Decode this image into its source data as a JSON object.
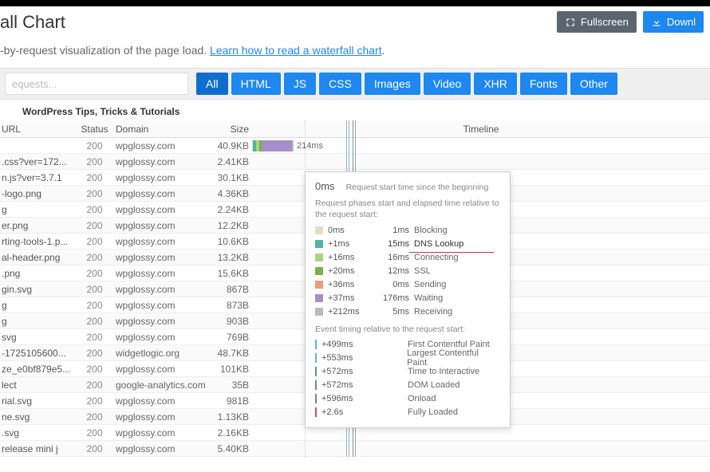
{
  "header": {
    "title_partial": "all Chart",
    "fullscreen": "Fullscreen",
    "download": "Downl"
  },
  "subtitle": {
    "lead": "-by-request visualization of the page load. ",
    "link": "Learn how to read a waterfall chart",
    "tail": "."
  },
  "filter": {
    "placeholder": "equests...",
    "tabs": [
      "All",
      "HTML",
      "JS",
      "CSS",
      "Images",
      "Video",
      "XHR",
      "Fonts",
      "Other"
    ],
    "active": 0
  },
  "page_label": "WordPress Tips, Tricks & Tutorials",
  "columns": {
    "url": "URL",
    "status": "Status",
    "domain": "Domain",
    "size": "Size",
    "timeline": "Timeline"
  },
  "rows": [
    {
      "url": "",
      "status": "200",
      "domain": "wpglossy.com",
      "size": "40.9KB",
      "label": "214ms"
    },
    {
      "url": ".css?ver=172...",
      "status": "200",
      "domain": "wpglossy.com",
      "size": "2.41KB"
    },
    {
      "url": "n.js?ver=3.7.1",
      "status": "200",
      "domain": "wpglossy.com",
      "size": "30.1KB"
    },
    {
      "url": "-logo.png",
      "status": "200",
      "domain": "wpglossy.com",
      "size": "4.36KB"
    },
    {
      "url": "g",
      "status": "200",
      "domain": "wpglossy.com",
      "size": "2.24KB"
    },
    {
      "url": "er.png",
      "status": "200",
      "domain": "wpglossy.com",
      "size": "12.2KB"
    },
    {
      "url": "rting-tools-1.p...",
      "status": "200",
      "domain": "wpglossy.com",
      "size": "10.6KB"
    },
    {
      "url": "al-header.png",
      "status": "200",
      "domain": "wpglossy.com",
      "size": "13.2KB"
    },
    {
      "url": ".png",
      "status": "200",
      "domain": "wpglossy.com",
      "size": "15.6KB"
    },
    {
      "url": "gin.svg",
      "status": "200",
      "domain": "wpglossy.com",
      "size": "867B"
    },
    {
      "url": "g",
      "status": "200",
      "domain": "wpglossy.com",
      "size": "873B"
    },
    {
      "url": "g",
      "status": "200",
      "domain": "wpglossy.com",
      "size": "903B"
    },
    {
      "url": "svg",
      "status": "200",
      "domain": "wpglossy.com",
      "size": "769B"
    },
    {
      "url": "-1725105600...",
      "status": "200",
      "domain": "widgetlogic.org",
      "size": "48.7KB"
    },
    {
      "url": "ze_e0bf879e5...",
      "status": "200",
      "domain": "wpglossy.com",
      "size": "101KB"
    },
    {
      "url": "lect",
      "status": "200",
      "domain": "google-analytics.com",
      "size": "35B"
    },
    {
      "url": "rial.svg",
      "status": "200",
      "domain": "wpglossy.com",
      "size": "981B"
    },
    {
      "url": "ne.svg",
      "status": "200",
      "domain": "wpglossy.com",
      "size": "1.13KB"
    },
    {
      "url": ".svg",
      "status": "200",
      "domain": "wpglossy.com",
      "size": "2.16KB"
    },
    {
      "url": "release mini j",
      "status": "200",
      "domain": "wpglossy.com",
      "size": "5.40KB"
    }
  ],
  "tooltip": {
    "head_time": "0ms",
    "head_label": "Request start time since the beginning",
    "sub1": "Request phases start and elapsed time relative to the request start:",
    "phases": [
      {
        "color": "#e6dcc6",
        "offset": "0ms",
        "dur": "1ms",
        "name": "Blocking"
      },
      {
        "color": "#4fb5a5",
        "offset": "+1ms",
        "dur": "15ms",
        "name": "DNS Lookup",
        "hl": true
      },
      {
        "color": "#a8d582",
        "offset": "+16ms",
        "dur": "16ms",
        "name": "Connecting"
      },
      {
        "color": "#7fb043",
        "offset": "+20ms",
        "dur": "12ms",
        "name": "SSL"
      },
      {
        "color": "#f09a7c",
        "offset": "+36ms",
        "dur": "0ms",
        "name": "Sending"
      },
      {
        "color": "#a58fc9",
        "offset": "+37ms",
        "dur": "176ms",
        "name": "Waiting"
      },
      {
        "color": "#bbb",
        "offset": "+212ms",
        "dur": "5ms",
        "name": "Receiving"
      }
    ],
    "sub2": "Event timing relative to the request start:",
    "events": [
      {
        "color": "#5bb5d6",
        "offset": "+499ms",
        "name": "First Contentful Paint"
      },
      {
        "color": "#5bb5d6",
        "offset": "+553ms",
        "name": "Largest Contentful Paint"
      },
      {
        "color": "#5b9676",
        "offset": "+572ms",
        "name": "Time to Interactive"
      },
      {
        "color": "#5b9676",
        "offset": "+572ms",
        "name": "DOM Loaded"
      },
      {
        "color": "#8b6fb5",
        "offset": "+596ms",
        "name": "Onload"
      },
      {
        "color": "#d44b6e",
        "offset": "+2.6s",
        "name": "Fully Loaded"
      }
    ]
  },
  "chart_data": {
    "type": "table",
    "title": "Waterfall request timing (first request)",
    "series": [
      {
        "name": "Blocking",
        "values": [
          1
        ]
      },
      {
        "name": "DNS Lookup",
        "values": [
          15
        ]
      },
      {
        "name": "Connecting",
        "values": [
          16
        ]
      },
      {
        "name": "SSL",
        "values": [
          12
        ]
      },
      {
        "name": "Sending",
        "values": [
          0
        ]
      },
      {
        "name": "Waiting",
        "values": [
          176
        ]
      },
      {
        "name": "Receiving",
        "values": [
          5
        ]
      }
    ],
    "total_ms": 214,
    "events_ms": {
      "FCP": 499,
      "LCP": 553,
      "TTI": 572,
      "DOMLoaded": 572,
      "Onload": 596,
      "FullyLoaded": 2600
    }
  }
}
